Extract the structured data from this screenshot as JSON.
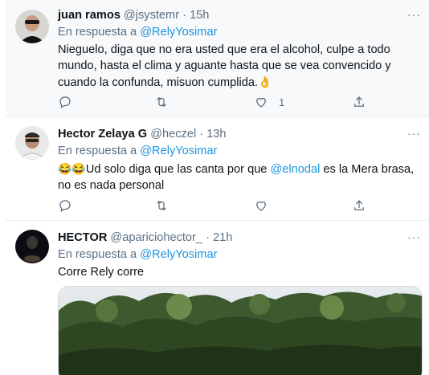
{
  "tweets": [
    {
      "name": "juan ramos",
      "handle": "@jsystemr",
      "dot": "·",
      "time": "15h",
      "reply_prefix": "En respuesta a",
      "reply_to": "@RelyYosimar",
      "text": "Nieguelo, diga que no era usted que era el alcohol, culpe a todo mundo, hasta el clima y aguante hasta que se vea convencido y cuando la confunda, misuon cumplida.",
      "emoji": "👌",
      "like_count": "1"
    },
    {
      "name": "Hector Zelaya G",
      "handle": "@heczel",
      "dot": "·",
      "time": "13h",
      "reply_prefix": "En respuesta a",
      "reply_to": "@RelyYosimar",
      "emoji_prefix": "😂😂",
      "text_part1": "Ud solo diga que las canta por que ",
      "mention": "@elnodal",
      "text_part2": " es la Mera brasa, no es nada personal"
    },
    {
      "name": "HECTOR",
      "handle": "@apariciohector_",
      "dot": "·",
      "time": "21h",
      "reply_prefix": "En respuesta a",
      "reply_to": "@RelyYosimar",
      "text": "Corre Rely corre"
    }
  ],
  "more_label": "···",
  "icons": [
    "reply-icon",
    "retweet-icon",
    "like-icon",
    "share-icon",
    "more-icon"
  ],
  "colors": {
    "accent": "#1b95e0",
    "secondary": "#5b7083",
    "highlight_bg": "#f7f9fa"
  }
}
